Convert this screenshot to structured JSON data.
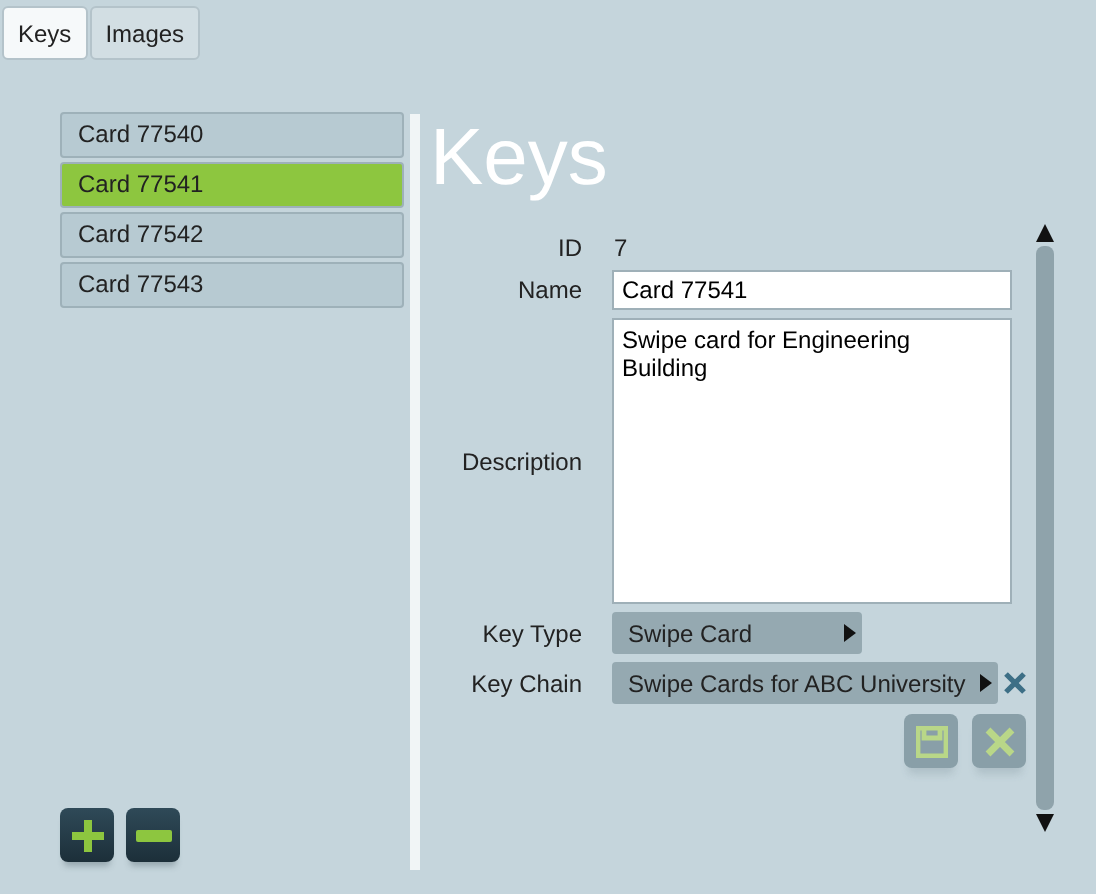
{
  "tabs": [
    {
      "label": "Keys",
      "selected": true
    },
    {
      "label": "Images",
      "selected": false
    }
  ],
  "keys": [
    {
      "label": "Card 77540",
      "selected": false
    },
    {
      "label": "Card 77541",
      "selected": true
    },
    {
      "label": "Card 77542",
      "selected": false
    },
    {
      "label": "Card 77543",
      "selected": false
    }
  ],
  "heading": "Keys",
  "form": {
    "id": {
      "label": "ID",
      "value": "7"
    },
    "name": {
      "label": "Name",
      "value": "Card 77541"
    },
    "description": {
      "label": "Description",
      "value": "Swipe card for Engineering Building"
    },
    "key_type": {
      "label": "Key Type",
      "value": "Swipe Card"
    },
    "key_chain": {
      "label": "Key Chain",
      "value": "Swipe Cards for ABC University"
    }
  },
  "save_disabled": true
}
